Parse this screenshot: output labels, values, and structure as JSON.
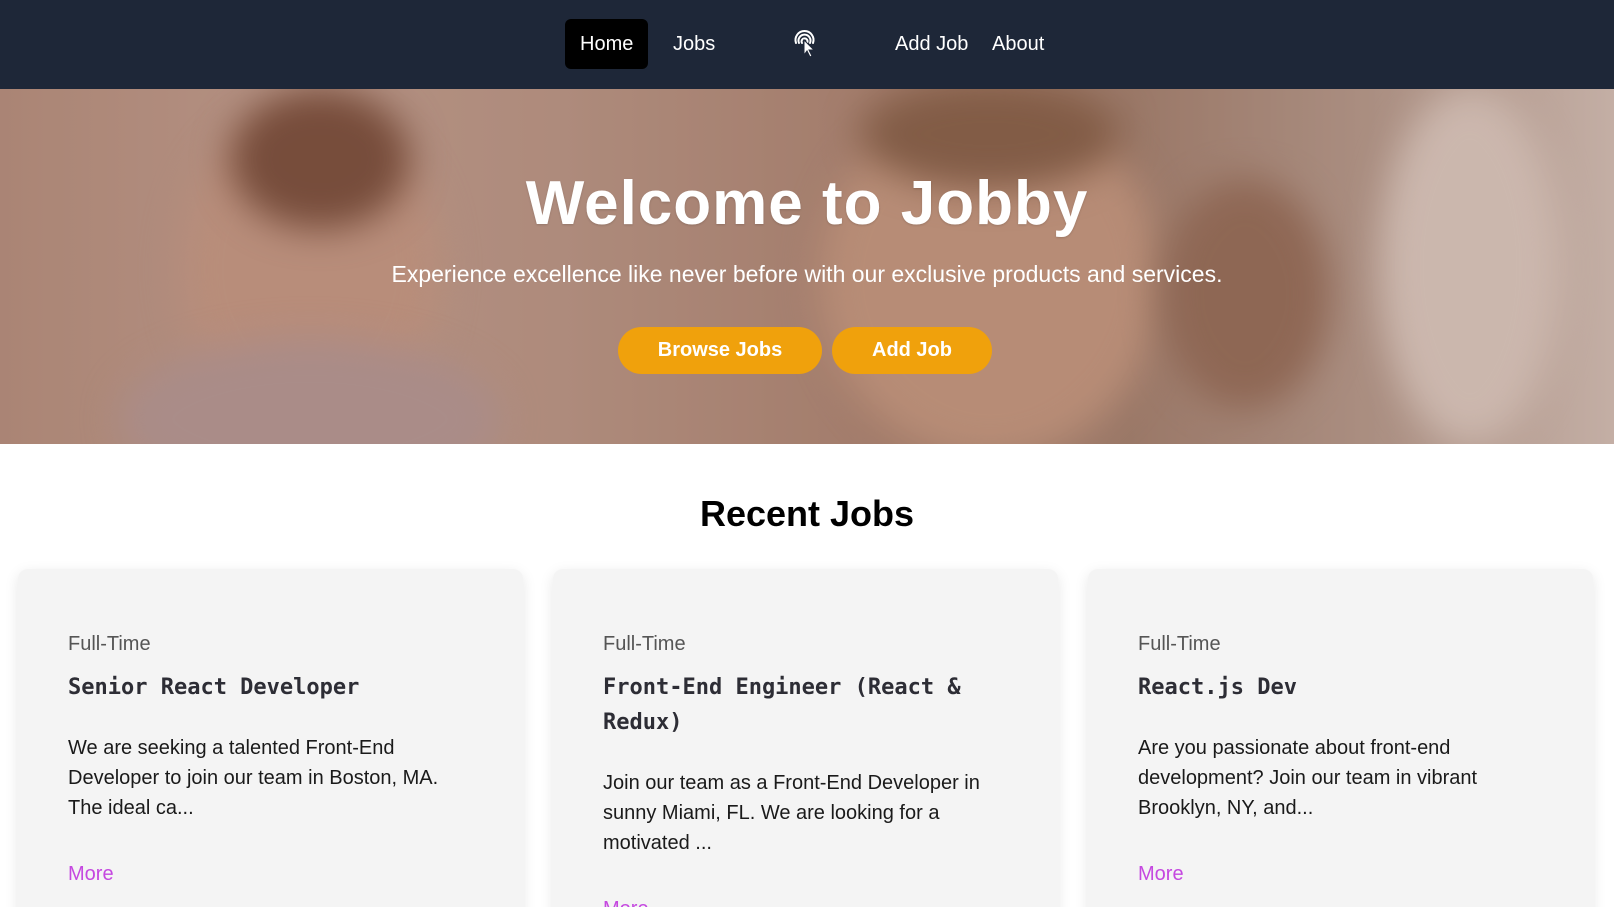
{
  "nav": {
    "links": [
      {
        "label": "Home",
        "active": true
      },
      {
        "label": "Jobs",
        "active": false
      },
      {
        "label": "Add Job",
        "active": false
      },
      {
        "label": "About",
        "active": false
      }
    ],
    "logo_icon": "pointer-tap-icon"
  },
  "hero": {
    "title": "Welcome to Jobby",
    "subtitle": "Experience excellence like never before with our exclusive products and services.",
    "buttons": {
      "browse": "Browse Jobs",
      "add": "Add Job"
    },
    "button_color": "#f0a10c"
  },
  "recent": {
    "title": "Recent Jobs",
    "jobs": [
      {
        "type": "Full-Time",
        "title": "Senior React Developer",
        "description": "We are seeking a talented Front-End Developer to join our team in Boston, MA. The ideal ca...",
        "more": "More"
      },
      {
        "type": "Full-Time",
        "title": "Front-End Engineer (React & Redux)",
        "description": "Join our team as a Front-End Developer in sunny Miami, FL. We are looking for a motivated ...",
        "more": "More"
      },
      {
        "type": "Full-Time",
        "title": "React.js Dev",
        "description": "Are you passionate about front-end development? Join our team in vibrant Brooklyn, NY, and...",
        "more": "More"
      }
    ]
  },
  "colors": {
    "navbar": "#1e2738",
    "accent_link": "#c548e0",
    "card_bg": "#f4f4f4"
  }
}
